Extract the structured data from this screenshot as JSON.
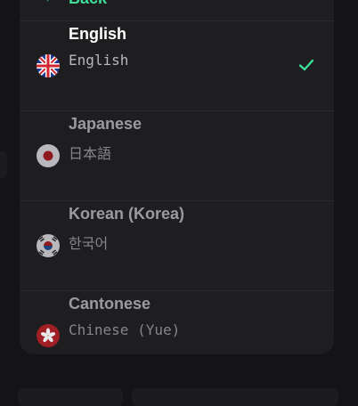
{
  "header": {
    "back_label": "Back"
  },
  "languages": [
    {
      "name": "English",
      "native": "English",
      "flag": "uk-flag-icon",
      "selected": true
    },
    {
      "name": "Japanese",
      "native": "日本語",
      "flag": "japan-flag-icon",
      "selected": false
    },
    {
      "name": "Korean (Korea)",
      "native": "한국어",
      "flag": "korea-flag-icon",
      "selected": false
    },
    {
      "name": "Cantonese",
      "native": "Chinese (Yue)",
      "flag": "hong-kong-flag-icon",
      "selected": false
    }
  ],
  "colors": {
    "accent": "#3ddc97",
    "panel": "#1e1e21",
    "background": "#141416"
  }
}
